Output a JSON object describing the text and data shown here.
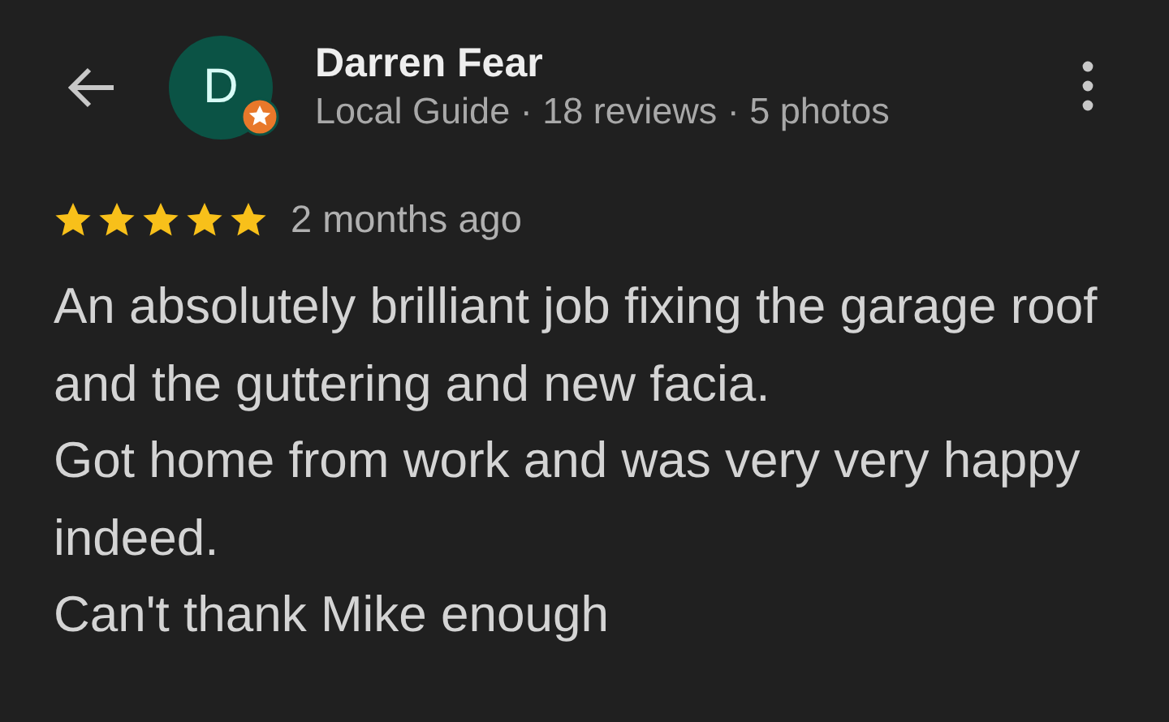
{
  "reviewer": {
    "initial": "D",
    "name": "Darren Fear",
    "details": "Local Guide · 18 reviews · 5 photos",
    "local_guide": true
  },
  "review": {
    "stars": 5,
    "time": "2 months ago",
    "paragraphs": [
      "An absolutely brilliant job fixing the garage roof and the guttering and new facia.",
      "Got home from work and was very very happy indeed.",
      "Can't thank Mike enough"
    ]
  }
}
